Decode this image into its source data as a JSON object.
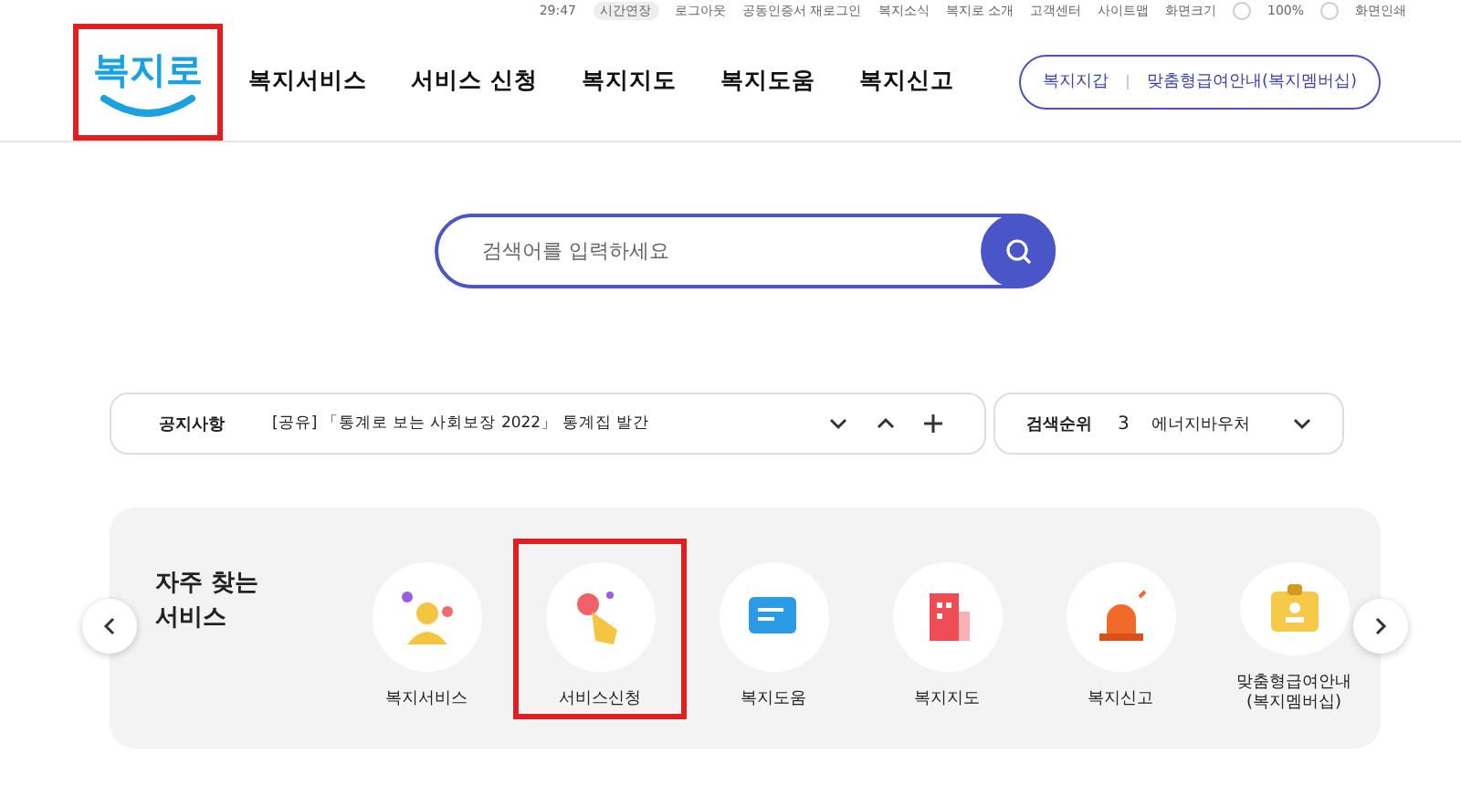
{
  "utility_bar": {
    "timer": "29:47",
    "extend_button": "시간연장",
    "links": [
      "로그아웃",
      "공동인증서 재로그인",
      "복지소식",
      "복지로 소개",
      "고객센터",
      "사이트맵"
    ],
    "zoom_label": "화면크기",
    "zoom_value": "100%",
    "print": "화면인쇄"
  },
  "logo": {
    "text": "복지로",
    "highlighted": true
  },
  "nav": [
    "복지서비스",
    "서비스 신청",
    "복지지도",
    "복지도움",
    "복지신고"
  ],
  "header_pill": [
    "복지지갑",
    "맞춤형급여안내(복지멤버십)"
  ],
  "search": {
    "placeholder": "검색어를 입력하세요"
  },
  "notice": {
    "label": "공지사항",
    "text": "[공유] 「통계로 보는 사회보장 2022」 통계집 발간"
  },
  "ranking": {
    "label": "검색순위",
    "rank": "3",
    "term": "에너지바우처"
  },
  "frequent": {
    "title": "자주 찾는\n서비스",
    "items": [
      {
        "kind": "people",
        "label": "복지서비스",
        "highlighted": false
      },
      {
        "kind": "tap",
        "label": "서비스신청",
        "highlighted": true
      },
      {
        "kind": "chat",
        "label": "복지도움",
        "highlighted": false
      },
      {
        "kind": "building",
        "label": "복지지도",
        "highlighted": false
      },
      {
        "kind": "siren",
        "label": "복지신고",
        "highlighted": false
      },
      {
        "kind": "badge",
        "label": "맞춤형급여안내\n(복지멤버십)",
        "highlighted": false
      }
    ]
  }
}
